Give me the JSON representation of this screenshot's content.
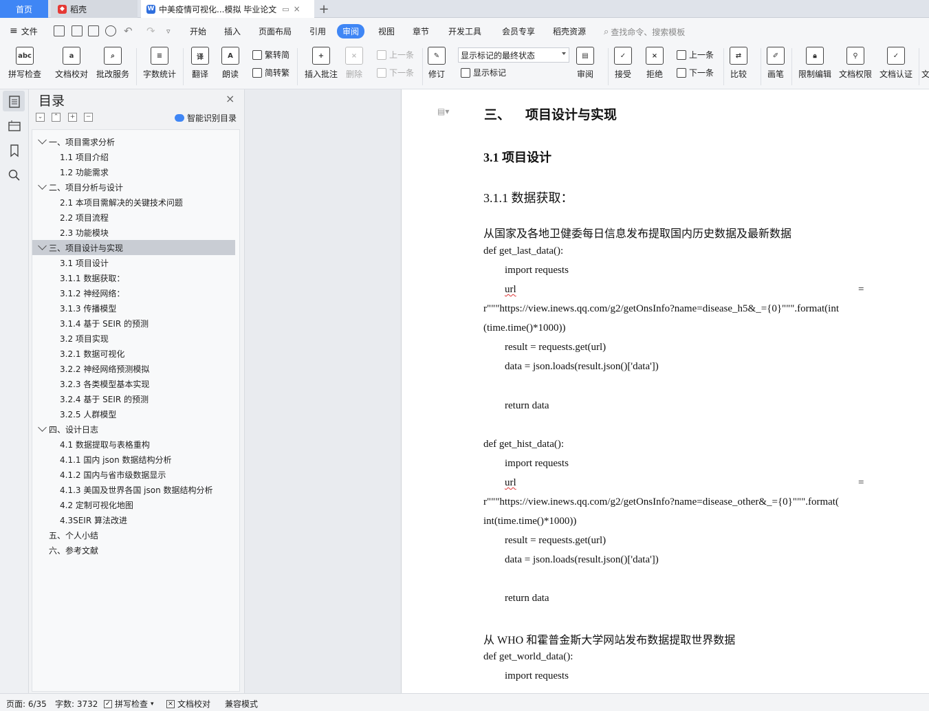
{
  "tabs": {
    "home": "首页",
    "daoke": "稻壳",
    "doc": "中美疫情可视化...模拟 毕业论文"
  },
  "menus": [
    "文件",
    "开始",
    "插入",
    "页面布局",
    "引用",
    "审阅",
    "视图",
    "章节",
    "开发工具",
    "会员专享",
    "稻壳资源"
  ],
  "active_menu": "审阅",
  "search_placeholder": "查找命令、搜索模板",
  "ribbon": {
    "spell": "拼写检查",
    "doc_check": "文档校对",
    "batch": "批改服务",
    "wordcount": "字数统计",
    "translate": "翻译",
    "read": "朗读",
    "trad": "繁转简",
    "simp": "简转繁",
    "insert_comment": "插入批注",
    "delete": "删除",
    "prev_comment": "上一条",
    "next_comment": "下一条",
    "revise": "修订",
    "markup_state": "显示标记的最终状态",
    "show_markup": "显示标记",
    "review": "审阅",
    "accept": "接受",
    "reject": "拒绝",
    "prev": "上一条",
    "next": "下一条",
    "compare": "比较",
    "pen": "画笔",
    "restrict": "限制编辑",
    "perm": "文档权限",
    "cert": "文档认证",
    "more": "文"
  },
  "toc": {
    "title": "目录",
    "smart": "智能识别目录",
    "items": [
      {
        "text": "一、项目需求分析",
        "level": 1,
        "caret": true
      },
      {
        "text": "1.1 项目介绍",
        "level": 2
      },
      {
        "text": "1.2 功能需求",
        "level": 2
      },
      {
        "text": "二、项目分析与设计",
        "level": 1,
        "caret": true
      },
      {
        "text": "2.1 本项目需解决的关键技术问题",
        "level": 2
      },
      {
        "text": "2.2 项目流程",
        "level": 2
      },
      {
        "text": "2.3 功能模块",
        "level": 2
      },
      {
        "text": "三、项目设计与实现",
        "level": 1,
        "caret": true,
        "selected": true
      },
      {
        "text": "3.1 项目设计",
        "level": 2
      },
      {
        "text": "3.1.1 数据获取：",
        "level": 2
      },
      {
        "text": "3.1.2 神经网络：",
        "level": 2
      },
      {
        "text": "3.1.3 传播模型",
        "level": 2
      },
      {
        "text": "3.1.4 基于 SEIR 的预测",
        "level": 2
      },
      {
        "text": "3.2 项目实现",
        "level": 2
      },
      {
        "text": "3.2.1 数据可视化",
        "level": 2
      },
      {
        "text": "3.2.2 神经网络预测模拟",
        "level": 2
      },
      {
        "text": "3.2.3 各类模型基本实现",
        "level": 2
      },
      {
        "text": "3.2.4 基于 SEIR 的预测",
        "level": 2
      },
      {
        "text": "3.2.5  人群模型",
        "level": 2
      },
      {
        "text": "四、设计日志",
        "level": 1,
        "caret": true
      },
      {
        "text": "4.1 数据提取与表格重构",
        "level": 2
      },
      {
        "text": "4.1.1 国内 json 数据结构分析",
        "level": 2
      },
      {
        "text": "4.1.2 国内与省市级数据显示",
        "level": 2
      },
      {
        "text": "4.1.3 美国及世界各国 json 数据结构分析",
        "level": 2
      },
      {
        "text": "4.2 定制可视化地图",
        "level": 2
      },
      {
        "text": "4.3SEIR 算法改进",
        "level": 2
      },
      {
        "text": "五、个人小结",
        "level": 1
      },
      {
        "text": "六、参考文献",
        "level": 1
      }
    ]
  },
  "doc": {
    "h1_num": "三、",
    "h1_text": "项目设计与实现",
    "h2": "3.1 项目设计",
    "h3": "3.1.1 数据获取：",
    "p1": "从国家及各地卫健委每日信息发布提取国内历史数据及最新数据",
    "c1": "def get_last_data():",
    "c2": "import requests",
    "c3_url": "url",
    "c3_eq": "=",
    "c4": "r\"\"\"https://view.inews.qq.com/g2/getOnsInfo?name=disease_h5&_={0}\"\"\".format(int",
    "c5": "(time.time()*1000))",
    "c6": "result = requests.get(url)",
    "c7": "data = json.loads(result.json()['data'])",
    "c8": "return data",
    "c9": "def get_hist_data():",
    "c10": "import requests",
    "c11_url": "url",
    "c11_eq": "=",
    "c12": "r\"\"\"https://view.inews.qq.com/g2/getOnsInfo?name=disease_other&_={0}\"\"\".format(",
    "c13": "int(time.time()*1000))",
    "c14": "result = requests.get(url)",
    "c15": "data = json.loads(result.json()['data'])",
    "c16": "return data",
    "p2": "从 WHO 和霍普金斯大学网站发布数据提取世界数据",
    "c17": "def get_world_data():",
    "c18": "import requests"
  },
  "status": {
    "page": "页面: 6/35",
    "words": "字数: 3732",
    "spell": "拼写检查",
    "check": "文档校对",
    "compat": "兼容模式"
  }
}
